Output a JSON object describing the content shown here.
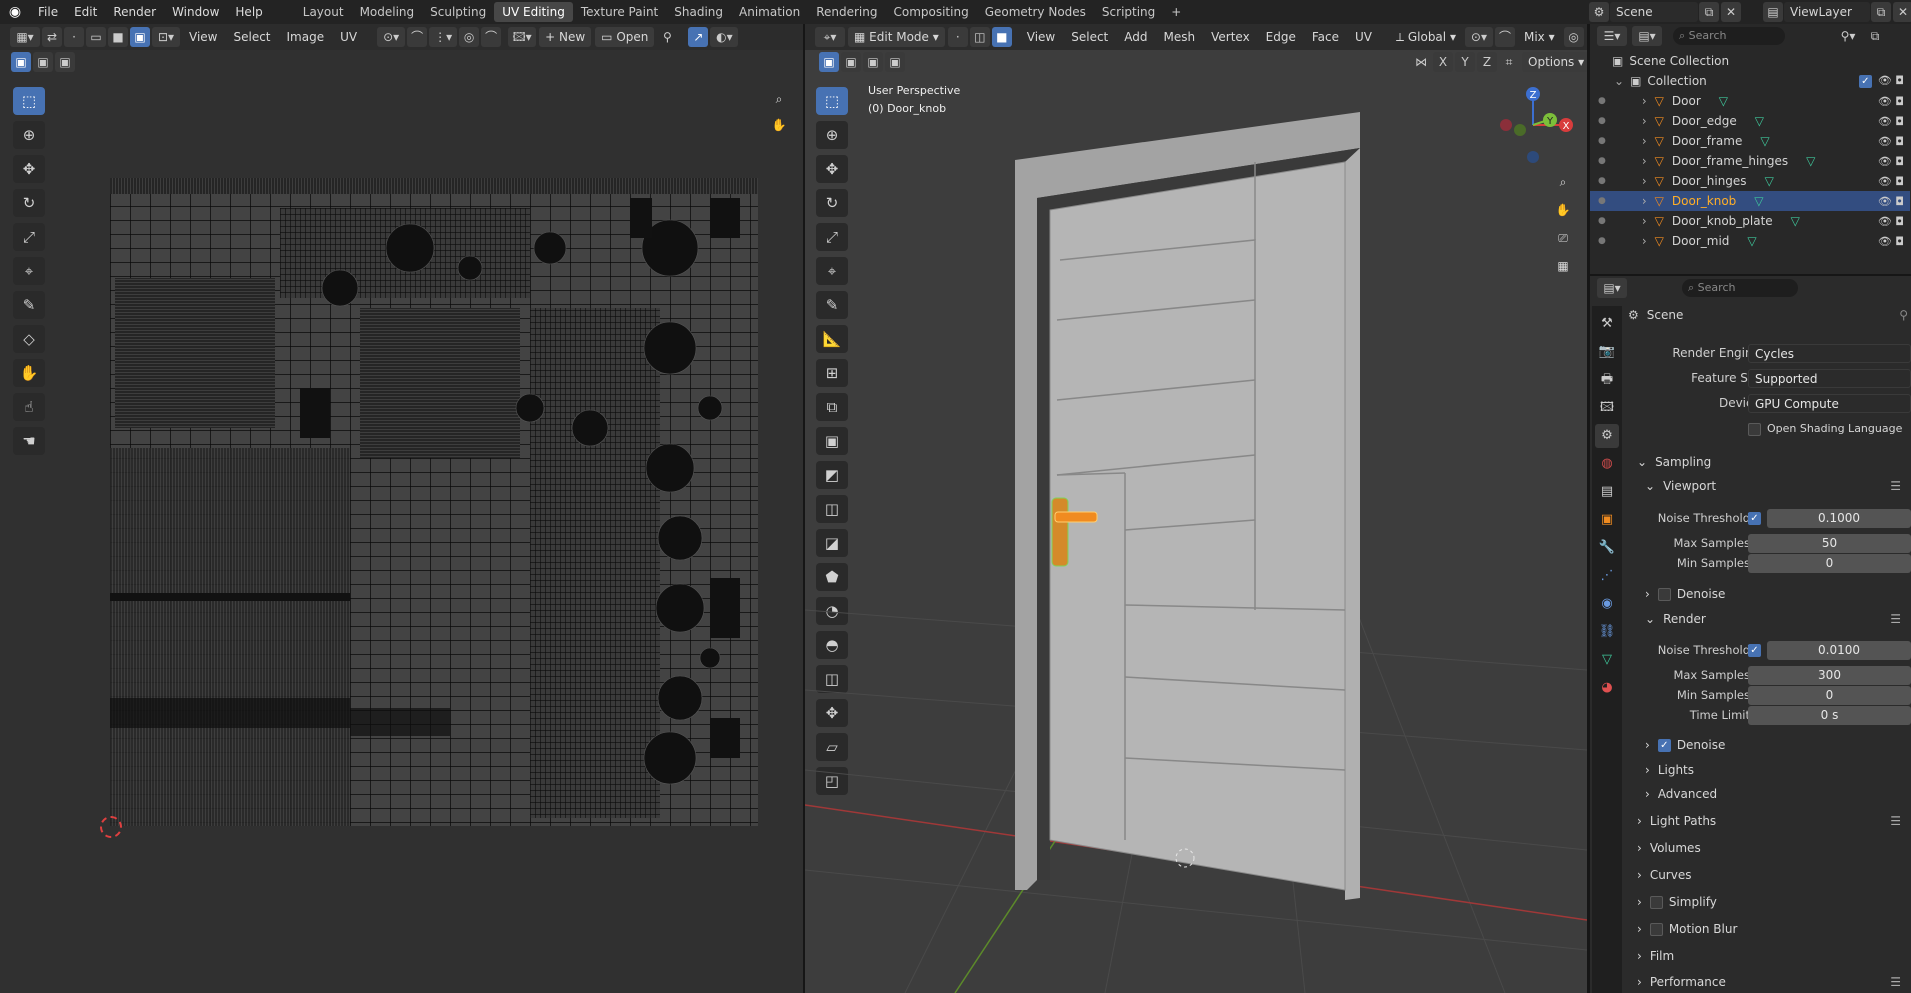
{
  "topbar": {
    "menus": [
      "File",
      "Edit",
      "Render",
      "Window",
      "Help"
    ],
    "workspaces": [
      "Layout",
      "Modeling",
      "Sculpting",
      "UV Editing",
      "Texture Paint",
      "Shading",
      "Animation",
      "Rendering",
      "Compositing",
      "Geometry Nodes",
      "Scripting"
    ],
    "active_workspace": "UV Editing",
    "scene_name": "Scene",
    "view_layer": "ViewLayer"
  },
  "uv_editor": {
    "menus": [
      "View",
      "Select",
      "Image",
      "UV"
    ],
    "new_label": "New",
    "open_label": "Open"
  },
  "viewport": {
    "mode": "Edit Mode",
    "menus": [
      "View",
      "Select",
      "Add",
      "Mesh",
      "Vertex",
      "Edge",
      "Face",
      "UV"
    ],
    "orientation": "Global",
    "overlay_mix": "Mix",
    "options_label": "Options",
    "overlay_title": "User Perspective",
    "overlay_object": "(0) Door_knob",
    "axes": [
      "X",
      "Y",
      "Z"
    ]
  },
  "outliner": {
    "search_placeholder": "Search",
    "scene_collection": "Scene Collection",
    "collection": "Collection",
    "items": [
      {
        "name": "Door",
        "selected": false
      },
      {
        "name": "Door_edge",
        "selected": false
      },
      {
        "name": "Door_frame",
        "selected": false
      },
      {
        "name": "Door_frame_hinges",
        "selected": false
      },
      {
        "name": "Door_hinges",
        "selected": false
      },
      {
        "name": "Door_knob",
        "selected": true
      },
      {
        "name": "Door_knob_plate",
        "selected": false
      },
      {
        "name": "Door_mid",
        "selected": false
      }
    ]
  },
  "properties": {
    "search_placeholder": "Search",
    "context": "Scene",
    "render_engine_label": "Render Engine",
    "render_engine": "Cycles",
    "feature_set_label": "Feature Set",
    "feature_set": "Supported",
    "device_label": "Device",
    "device": "GPU Compute",
    "osl_label": "Open Shading Language",
    "sampling": "Sampling",
    "viewport": "Viewport",
    "noise_threshold_label": "Noise Threshold",
    "vp_noise_threshold": "0.1000",
    "max_samples_label": "Max Samples",
    "vp_max_samples": "50",
    "min_samples_label": "Min Samples",
    "vp_min_samples": "0",
    "denoise_label": "Denoise",
    "render": "Render",
    "r_noise_threshold": "0.0100",
    "r_max_samples": "300",
    "r_min_samples": "0",
    "time_limit_label": "Time Limit",
    "r_time_limit": "0 s",
    "lights": "Lights",
    "advanced": "Advanced",
    "light_paths": "Light Paths",
    "volumes": "Volumes",
    "curves": "Curves",
    "simplify": "Simplify",
    "motion_blur": "Motion Blur",
    "film": "Film",
    "performance": "Performance"
  },
  "colors": {
    "accent": "#4772b3",
    "selected_text": "#ffaf29",
    "uv_bg": "#404040"
  }
}
